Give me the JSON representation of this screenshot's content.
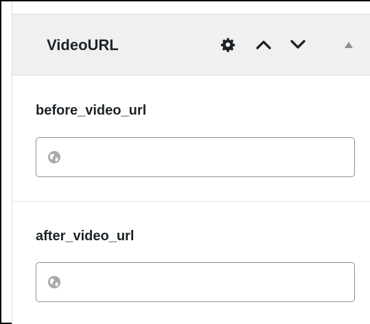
{
  "section": {
    "title": "VideoURL"
  },
  "fields": [
    {
      "label": "before_video_url",
      "value": "",
      "placeholder": ""
    },
    {
      "label": "after_video_url",
      "value": "",
      "placeholder": ""
    }
  ],
  "icons": {
    "settings": "gear-icon",
    "move_up": "chevron-up-icon",
    "move_down": "chevron-down-icon",
    "collapse": "triangle-up-icon",
    "url_prefix": "globe-icon"
  },
  "colors": {
    "header_bg": "#f0f0f1",
    "text": "#1d2327",
    "icon": "#1d2327",
    "collapse_icon": "#8c8f94",
    "input_border": "#8c8f94",
    "globe": "#a7aaad"
  }
}
